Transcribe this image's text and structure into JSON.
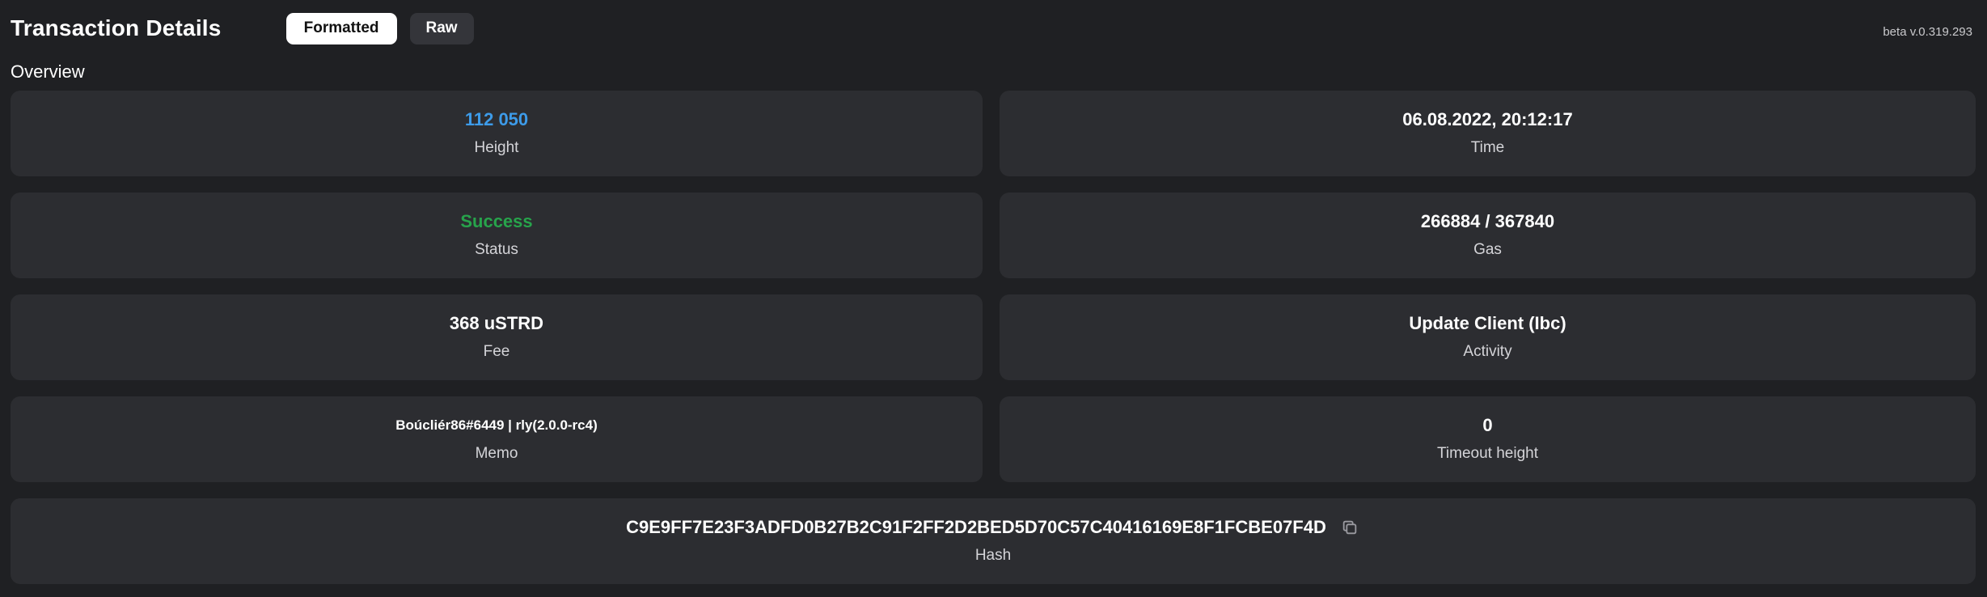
{
  "header": {
    "title": "Transaction Details",
    "tabs": {
      "formatted": "Formatted",
      "raw": "Raw"
    },
    "version": "beta v.0.319.293"
  },
  "overview": {
    "label": "Overview",
    "height": {
      "value": "112 050",
      "label": "Height"
    },
    "time": {
      "value": "06.08.2022, 20:12:17",
      "label": "Time"
    },
    "status": {
      "value": "Success",
      "label": "Status"
    },
    "gas": {
      "value": "266884 / 367840",
      "label": "Gas"
    },
    "fee": {
      "value": "368 uSTRD",
      "label": "Fee"
    },
    "activity": {
      "value": "Update Client (Ibc)",
      "label": "Activity"
    },
    "memo": {
      "value": "Boúcliér86#6449 | rly(2.0.0-rc4)",
      "label": "Memo"
    },
    "timeout": {
      "value": "0",
      "label": "Timeout height"
    },
    "hash": {
      "value": "C9E9FF7E23F3ADFD0B27B2C91F2FF2D2BED5D70C57C40416169E8F1FCBE07F4D",
      "label": "Hash"
    }
  },
  "colors": {
    "background": "#1f2023",
    "card": "#2c2d31",
    "height_value": "#3d9be9",
    "status_success": "#27a34b"
  },
  "icons": {
    "copy": "copy-icon"
  }
}
